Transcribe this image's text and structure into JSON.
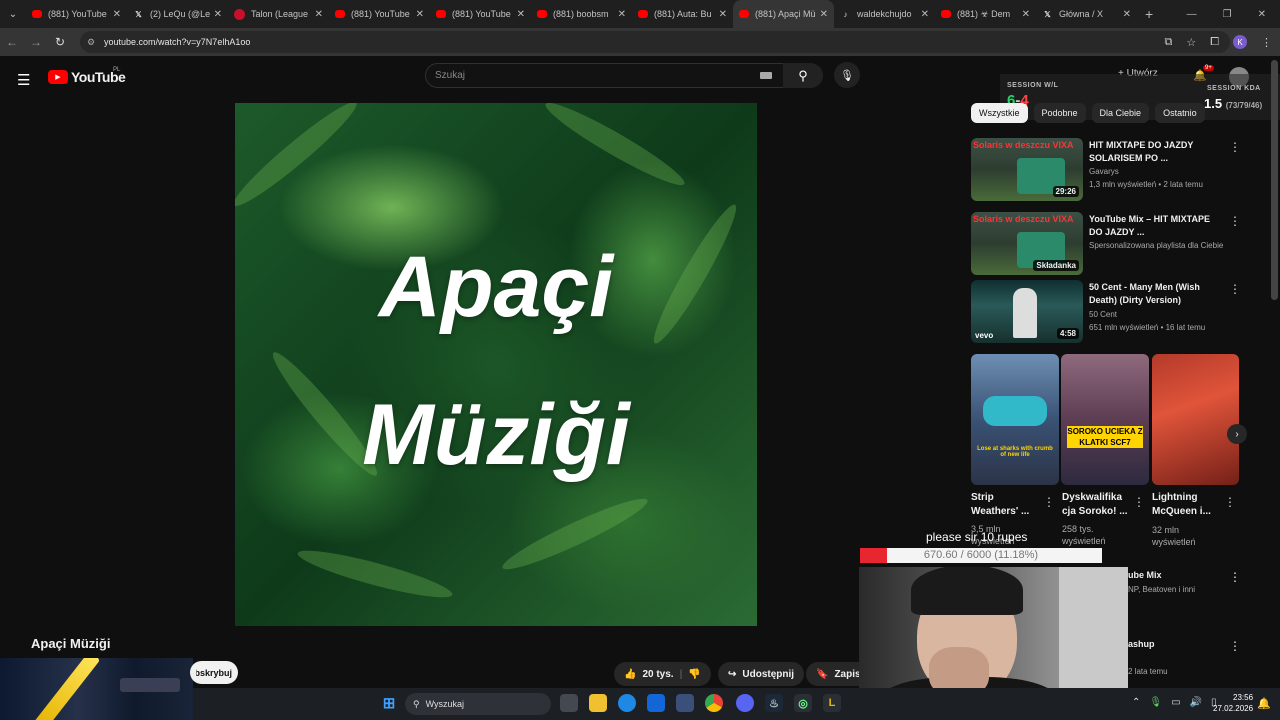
{
  "browser": {
    "tabs": [
      {
        "label": "(881) YouTube",
        "icon": "youtube-icon"
      },
      {
        "label": "(2) LeQu (@Le",
        "icon": "x-icon"
      },
      {
        "label": "Talon (League",
        "icon": "league-icon"
      },
      {
        "label": "(881) YouTube",
        "icon": "youtube-icon"
      },
      {
        "label": "(881) YouTube",
        "icon": "youtube-icon"
      },
      {
        "label": "(881) boobsm",
        "icon": "youtube-icon"
      },
      {
        "label": "(881) Auta: Bu",
        "icon": "youtube-icon"
      },
      {
        "label": "(881) Apaçi Mü",
        "icon": "youtube-icon",
        "active": true
      },
      {
        "label": "waldekchujdo",
        "icon": "tiktok-icon"
      },
      {
        "label": "(881) ☣ Dem",
        "icon": "youtube-icon"
      },
      {
        "label": "Główna / X",
        "icon": "x-icon"
      }
    ],
    "url": "youtube.com/watch?v=y7N7elhA1oo",
    "profile_initial": "K"
  },
  "youtube": {
    "logo_text": "YouTube",
    "region": "PL",
    "search_placeholder": "Szukaj",
    "create_label": "Utwórz",
    "notifications": "9+"
  },
  "overlay": {
    "session_wl_label": "SESSION W/L",
    "session_w": "6",
    "session_l": "4",
    "session_kda_label": "SESSION KDA",
    "session_kda_value": "1.5",
    "session_kda_detail": "(73/79/46)"
  },
  "chips": [
    "Wszystkie",
    "Podobne",
    "Dla Ciebie",
    "Ostatnio"
  ],
  "recommendations": [
    {
      "title": "HIT MIXTAPE DO JAZDY SOLARISEM PO ...",
      "channel": "Gavarys",
      "meta": "1,3 mln wyświetleń • 2 lata temu",
      "duration": "29:26",
      "caption": "Solaris w deszczu VIXA"
    },
    {
      "title": "YouTube Mix – HIT MIXTAPE DO JAZDY ...",
      "channel": "Spersonalizowana playlista dla Ciebie",
      "meta": "",
      "duration": "Składanka",
      "caption": "Solaris w deszczu VIXA"
    },
    {
      "title": "50 Cent - Many Men (Wish Death) (Dirty Version)",
      "channel": "50 Cent",
      "meta": "651 mln wyświetleń • 16 lat temu",
      "duration": "4:58",
      "caption": "vevo"
    }
  ],
  "shorts": [
    {
      "title": "Strip Weathers' ...",
      "meta": "3,5 mln wyświetleń",
      "overlay": "Lose at sharks with crumb of new life"
    },
    {
      "title": "Dyskwalifika cja Soroko! ...",
      "meta": "258 tys. wyświetleń",
      "overlay": "SOROKO UCIEKA Z KLATKI SCF7"
    },
    {
      "title": "Lightning McQueen i...",
      "meta": "32 mln wyświetleń",
      "overlay": ""
    }
  ],
  "partial_recs": [
    {
      "title": "ube Mix",
      "meta": "NP, Beatoven i inni"
    },
    {
      "title": "ashup",
      "meta": "2 lata temu"
    }
  ],
  "video": {
    "title_line1": "Apaçi",
    "title_line2": "Müziği",
    "title_below": "Apaçi Müziği",
    "subscribe": "Subskrybuj",
    "likes": "20 tys.",
    "share": "Udostępnij",
    "save": "Zapisz"
  },
  "donation": {
    "message": "please sir 10 rupes",
    "progress_text": "670.60 / 6000 (11.18%)",
    "progress_fraction": 0.1118
  },
  "taskbar": {
    "search_placeholder": "Wyszukaj",
    "time": "23:56",
    "date": "27.02.2026"
  }
}
